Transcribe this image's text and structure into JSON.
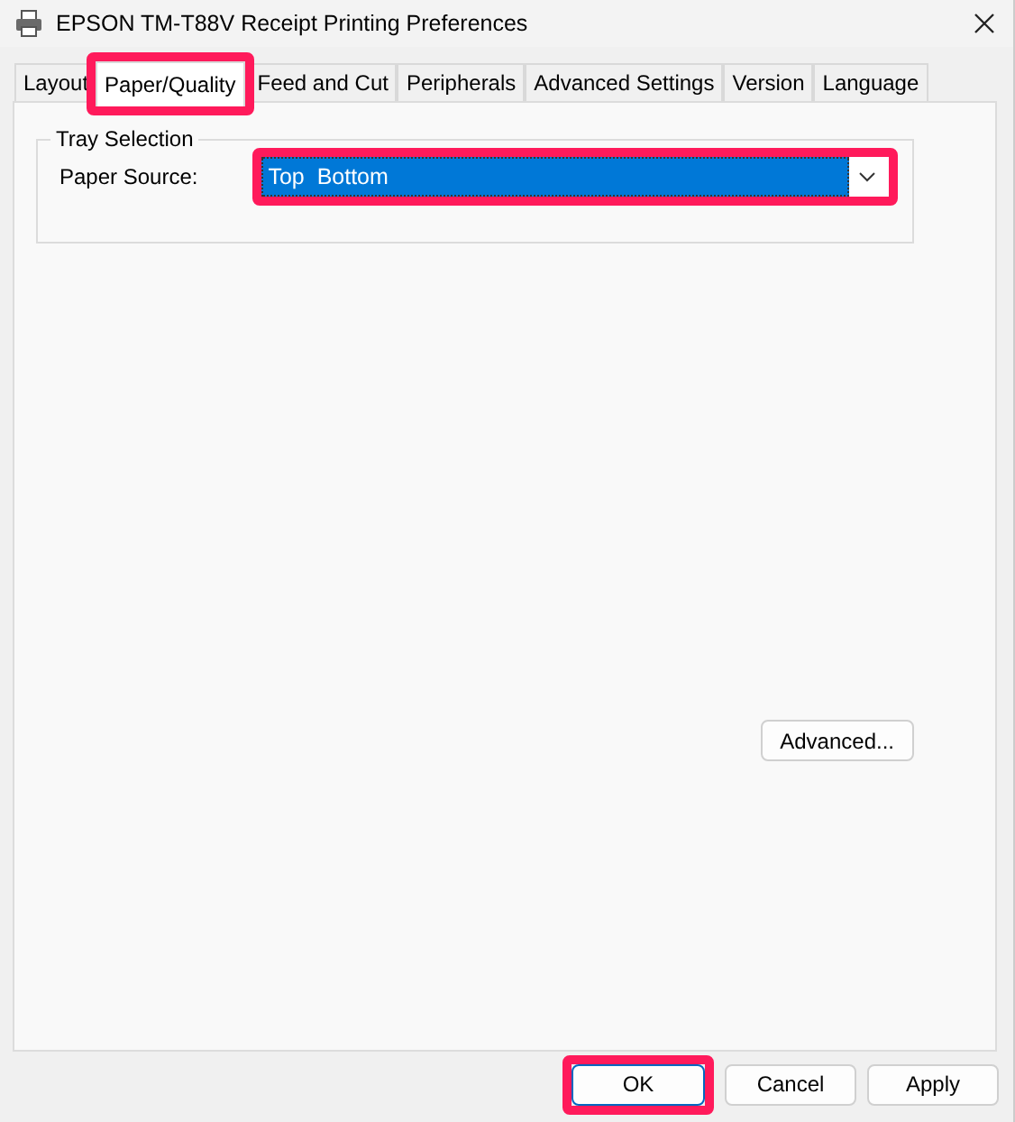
{
  "window": {
    "title": "EPSON TM-T88V Receipt Printing Preferences"
  },
  "tabs": [
    {
      "label": "Layout",
      "selected": false,
      "highlighted": false
    },
    {
      "label": "Paper/Quality",
      "selected": true,
      "highlighted": true
    },
    {
      "label": "Feed and Cut",
      "selected": false,
      "highlighted": false
    },
    {
      "label": "Peripherals",
      "selected": false,
      "highlighted": false
    },
    {
      "label": "Advanced Settings",
      "selected": false,
      "highlighted": false
    },
    {
      "label": "Version",
      "selected": false,
      "highlighted": false
    },
    {
      "label": "Language",
      "selected": false,
      "highlighted": false
    }
  ],
  "tray_selection": {
    "title": "Tray Selection",
    "label": "Paper Source:",
    "value": "Top  Bottom",
    "highlighted": true
  },
  "advanced_button": "Advanced...",
  "buttons": [
    {
      "label": "OK",
      "highlighted": true
    },
    {
      "label": "Cancel",
      "highlighted": false
    },
    {
      "label": "Apply",
      "highlighted": false
    }
  ]
}
